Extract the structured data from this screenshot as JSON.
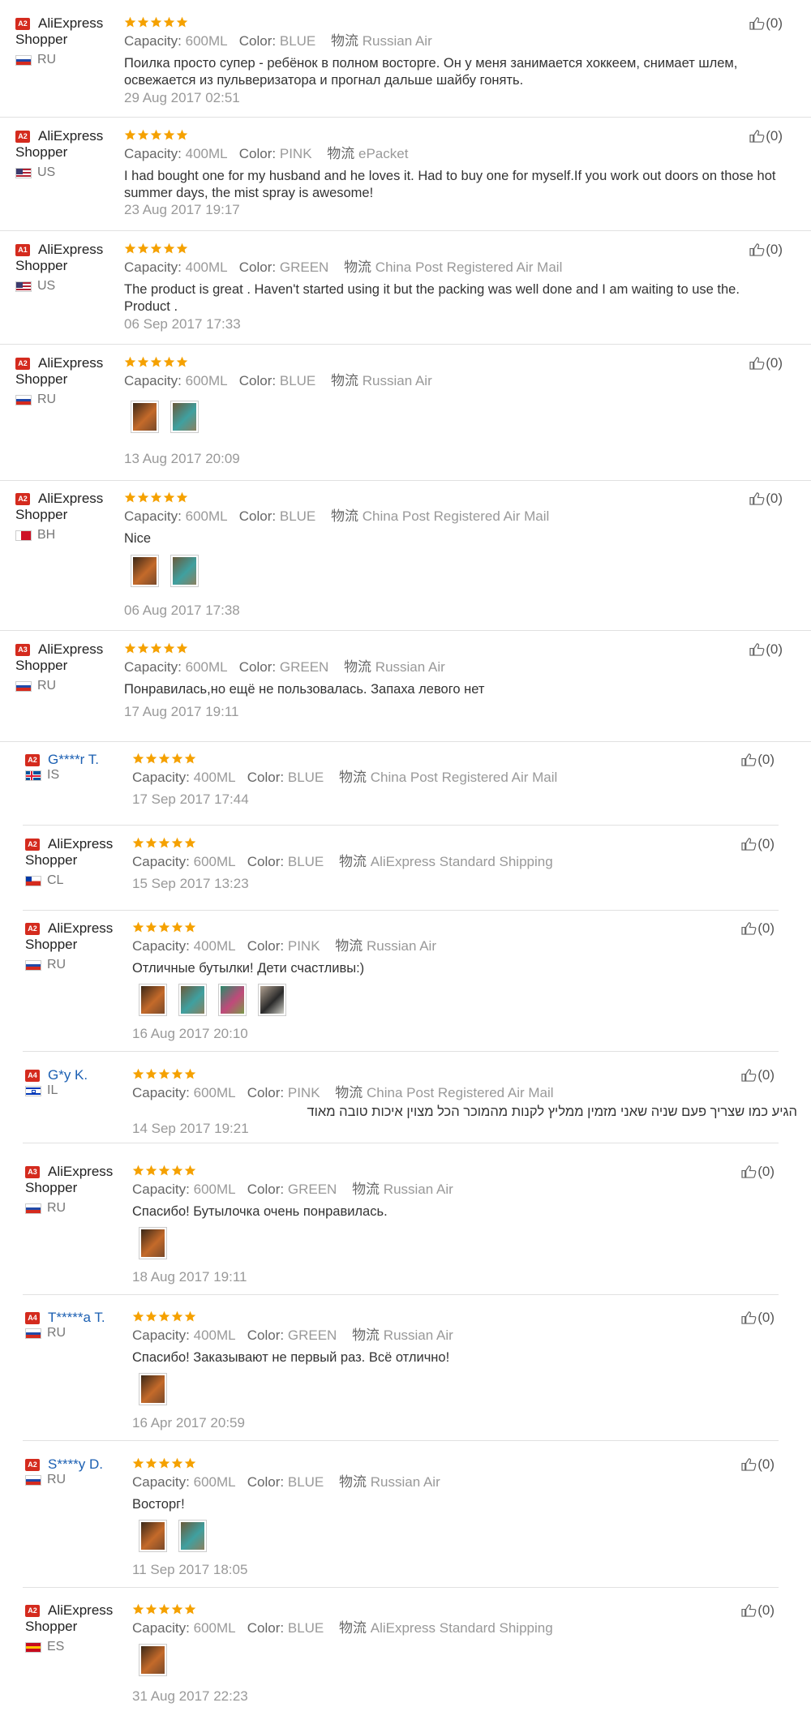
{
  "labels": {
    "capacity": "Capacity:",
    "color": "Color:",
    "logistics": "物流",
    "like_count": "(0)"
  },
  "colors": {
    "star": "#f5a100",
    "badge": "#d42b1e",
    "link_name": "#1b5fb2"
  },
  "reviews": [
    {
      "badge": "A2",
      "name1": "AliExpress",
      "name2": "Shopper",
      "country": "RU",
      "flag": "ru",
      "capacity": "600ML",
      "color": "BLUE",
      "shipping": "Russian Air",
      "text": "Поилка просто супер - ребёнок в полном восторге. Он у меня занимается хоккеем, снимает шлем, освежается из пульверизатора и прогнал дальше шайбу гонять.",
      "date": "29 Aug 2017 02:51",
      "photos": []
    },
    {
      "badge": "A2",
      "name1": "AliExpress",
      "name2": "Shopper",
      "country": "US",
      "flag": "us",
      "capacity": "400ML",
      "color": "PINK",
      "shipping": "ePacket",
      "text": "I had bought one for my husband and he loves it. Had to buy one for myself.If you work out doors on those hot summer days, the mist spray is awesome!",
      "date": "23 Aug 2017 19:17",
      "photos": []
    },
    {
      "badge": "A1",
      "name1": "AliExpress",
      "name2": "Shopper",
      "country": "US",
      "flag": "us",
      "capacity": "400ML",
      "color": "GREEN",
      "shipping": "China Post Registered Air Mail",
      "text": "The product is great . Haven't started using it but the packing was well done and I am waiting to use the. Product .",
      "date": "06 Sep 2017 17:33",
      "photos": []
    },
    {
      "badge": "A2",
      "name1": "AliExpress",
      "name2": "Shopper",
      "country": "RU",
      "flag": "ru",
      "capacity": "600ML",
      "color": "BLUE",
      "shipping": "Russian Air",
      "text": "",
      "date": "13 Aug 2017 20:09",
      "photos": [
        "photo-1",
        "photo-2"
      ]
    },
    {
      "badge": "A2",
      "name1": "AliExpress",
      "name2": "Shopper",
      "country": "BH",
      "flag": "bh",
      "capacity": "600ML",
      "color": "BLUE",
      "shipping": "China Post Registered Air Mail",
      "text": "Nice",
      "date": "06 Aug 2017 17:38",
      "photos": [
        "photo-1",
        "photo-2"
      ]
    },
    {
      "badge": "A3",
      "name1": "AliExpress",
      "name2": "Shopper",
      "country": "RU",
      "flag": "ru",
      "capacity": "600ML",
      "color": "GREEN",
      "shipping": "Russian Air",
      "text": "Понравилась,но ещё не пользовалась. Запаха левого нет",
      "date": "17 Aug 2017 19:11",
      "photos": []
    },
    {
      "badge": "A2",
      "name1": "G****r T.",
      "name2": "",
      "country": "IS",
      "flag": "is",
      "capacity": "400ML",
      "color": "BLUE",
      "shipping": "China Post Registered Air Mail",
      "text": "",
      "date": "17 Sep 2017 17:44",
      "photos": []
    },
    {
      "badge": "A2",
      "name1": "AliExpress",
      "name2": "Shopper",
      "country": "CL",
      "flag": "cl",
      "capacity": "600ML",
      "color": "BLUE",
      "shipping": "AliExpress Standard Shipping",
      "text": "",
      "date": "15 Sep 2017 13:23",
      "photos": []
    },
    {
      "badge": "A2",
      "name1": "AliExpress",
      "name2": "Shopper",
      "country": "RU",
      "flag": "ru",
      "capacity": "400ML",
      "color": "PINK",
      "shipping": "Russian Air",
      "text": "Отличные бутылки! Дети счастливы:)",
      "date": "16 Aug 2017 20:10",
      "photos": [
        "photo-1",
        "photo-2",
        "photo-3",
        "photo-4"
      ]
    },
    {
      "badge": "A4",
      "name1": "G*y K.",
      "name2": "",
      "country": "IL",
      "flag": "il",
      "capacity": "600ML",
      "color": "PINK",
      "shipping": "China Post Registered Air Mail",
      "text": "הגיע כמו שצריך פעם שניה שאני מזמין ממליץ לקנות מהמוכר הכל מצוין איכות טובה מאוד",
      "date": "14 Sep 2017 19:21",
      "photos": []
    },
    {
      "badge": "A3",
      "name1": "AliExpress",
      "name2": "Shopper",
      "country": "RU",
      "flag": "ru",
      "capacity": "600ML",
      "color": "GREEN",
      "shipping": "Russian Air",
      "text": "Спасибо! Бутылочка очень понравилась.",
      "date": "18 Aug 2017 19:11",
      "photos": [
        "photo-1"
      ]
    },
    {
      "badge": "A4",
      "name1": "T*****a T.",
      "name2": "",
      "country": "RU",
      "flag": "ru",
      "capacity": "400ML",
      "color": "GREEN",
      "shipping": "Russian Air",
      "text": "Спасибо! Заказывают не первый раз. Всё отлично!",
      "date": "16 Apr 2017 20:59",
      "photos": [
        "photo-1"
      ]
    },
    {
      "badge": "A2",
      "name1": "S****y D.",
      "name2": "",
      "country": "RU",
      "flag": "ru",
      "capacity": "600ML",
      "color": "BLUE",
      "shipping": "Russian Air",
      "text": "Восторг!",
      "date": "11 Sep 2017 18:05",
      "photos": [
        "photo-1",
        "photo-2"
      ]
    },
    {
      "badge": "A2",
      "name1": "AliExpress",
      "name2": "Shopper",
      "country": "ES",
      "flag": "es",
      "capacity": "600ML",
      "color": "BLUE",
      "shipping": "AliExpress Standard Shipping",
      "text": "",
      "date": "31 Aug 2017 22:23",
      "photos": [
        "photo-1"
      ]
    }
  ]
}
